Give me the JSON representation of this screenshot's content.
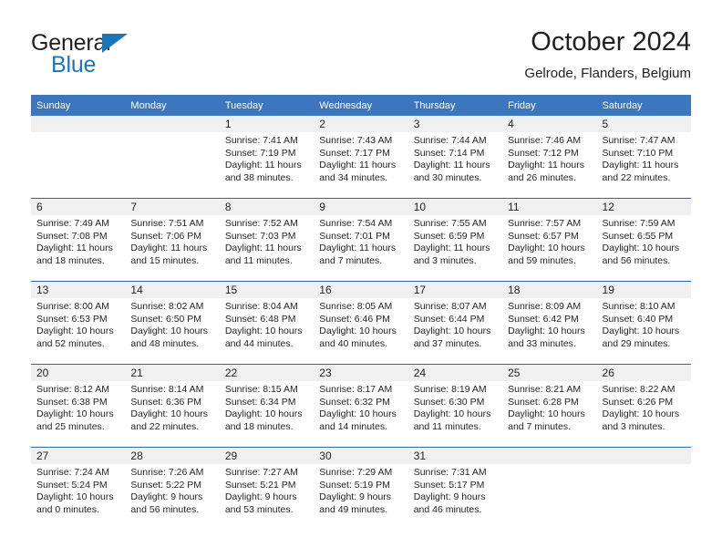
{
  "brand": {
    "name_part1": "General",
    "name_part2": "Blue",
    "accent_color": "#1b75bb",
    "triangle_icon": "brand-triangle-icon"
  },
  "header": {
    "title": "October 2024",
    "subtitle": "Gelrode, Flanders, Belgium"
  },
  "theme": {
    "header_blue": "#3b76bf",
    "row_rule_blue": "#2c6aa8",
    "daynum_band": "#f0f0f0",
    "text": "#231f20"
  },
  "weekday_headers": [
    "Sunday",
    "Monday",
    "Tuesday",
    "Wednesday",
    "Thursday",
    "Friday",
    "Saturday"
  ],
  "weeks": [
    [
      {
        "day": "",
        "sunrise": "",
        "sunset": "",
        "daylight_line1": "",
        "daylight_line2": ""
      },
      {
        "day": "",
        "sunrise": "",
        "sunset": "",
        "daylight_line1": "",
        "daylight_line2": ""
      },
      {
        "day": "1",
        "sunrise": "Sunrise: 7:41 AM",
        "sunset": "Sunset: 7:19 PM",
        "daylight_line1": "Daylight: 11 hours",
        "daylight_line2": "and 38 minutes."
      },
      {
        "day": "2",
        "sunrise": "Sunrise: 7:43 AM",
        "sunset": "Sunset: 7:17 PM",
        "daylight_line1": "Daylight: 11 hours",
        "daylight_line2": "and 34 minutes."
      },
      {
        "day": "3",
        "sunrise": "Sunrise: 7:44 AM",
        "sunset": "Sunset: 7:14 PM",
        "daylight_line1": "Daylight: 11 hours",
        "daylight_line2": "and 30 minutes."
      },
      {
        "day": "4",
        "sunrise": "Sunrise: 7:46 AM",
        "sunset": "Sunset: 7:12 PM",
        "daylight_line1": "Daylight: 11 hours",
        "daylight_line2": "and 26 minutes."
      },
      {
        "day": "5",
        "sunrise": "Sunrise: 7:47 AM",
        "sunset": "Sunset: 7:10 PM",
        "daylight_line1": "Daylight: 11 hours",
        "daylight_line2": "and 22 minutes."
      }
    ],
    [
      {
        "day": "6",
        "sunrise": "Sunrise: 7:49 AM",
        "sunset": "Sunset: 7:08 PM",
        "daylight_line1": "Daylight: 11 hours",
        "daylight_line2": "and 18 minutes."
      },
      {
        "day": "7",
        "sunrise": "Sunrise: 7:51 AM",
        "sunset": "Sunset: 7:06 PM",
        "daylight_line1": "Daylight: 11 hours",
        "daylight_line2": "and 15 minutes."
      },
      {
        "day": "8",
        "sunrise": "Sunrise: 7:52 AM",
        "sunset": "Sunset: 7:03 PM",
        "daylight_line1": "Daylight: 11 hours",
        "daylight_line2": "and 11 minutes."
      },
      {
        "day": "9",
        "sunrise": "Sunrise: 7:54 AM",
        "sunset": "Sunset: 7:01 PM",
        "daylight_line1": "Daylight: 11 hours",
        "daylight_line2": "and 7 minutes."
      },
      {
        "day": "10",
        "sunrise": "Sunrise: 7:55 AM",
        "sunset": "Sunset: 6:59 PM",
        "daylight_line1": "Daylight: 11 hours",
        "daylight_line2": "and 3 minutes."
      },
      {
        "day": "11",
        "sunrise": "Sunrise: 7:57 AM",
        "sunset": "Sunset: 6:57 PM",
        "daylight_line1": "Daylight: 10 hours",
        "daylight_line2": "and 59 minutes."
      },
      {
        "day": "12",
        "sunrise": "Sunrise: 7:59 AM",
        "sunset": "Sunset: 6:55 PM",
        "daylight_line1": "Daylight: 10 hours",
        "daylight_line2": "and 56 minutes."
      }
    ],
    [
      {
        "day": "13",
        "sunrise": "Sunrise: 8:00 AM",
        "sunset": "Sunset: 6:53 PM",
        "daylight_line1": "Daylight: 10 hours",
        "daylight_line2": "and 52 minutes."
      },
      {
        "day": "14",
        "sunrise": "Sunrise: 8:02 AM",
        "sunset": "Sunset: 6:50 PM",
        "daylight_line1": "Daylight: 10 hours",
        "daylight_line2": "and 48 minutes."
      },
      {
        "day": "15",
        "sunrise": "Sunrise: 8:04 AM",
        "sunset": "Sunset: 6:48 PM",
        "daylight_line1": "Daylight: 10 hours",
        "daylight_line2": "and 44 minutes."
      },
      {
        "day": "16",
        "sunrise": "Sunrise: 8:05 AM",
        "sunset": "Sunset: 6:46 PM",
        "daylight_line1": "Daylight: 10 hours",
        "daylight_line2": "and 40 minutes."
      },
      {
        "day": "17",
        "sunrise": "Sunrise: 8:07 AM",
        "sunset": "Sunset: 6:44 PM",
        "daylight_line1": "Daylight: 10 hours",
        "daylight_line2": "and 37 minutes."
      },
      {
        "day": "18",
        "sunrise": "Sunrise: 8:09 AM",
        "sunset": "Sunset: 6:42 PM",
        "daylight_line1": "Daylight: 10 hours",
        "daylight_line2": "and 33 minutes."
      },
      {
        "day": "19",
        "sunrise": "Sunrise: 8:10 AM",
        "sunset": "Sunset: 6:40 PM",
        "daylight_line1": "Daylight: 10 hours",
        "daylight_line2": "and 29 minutes."
      }
    ],
    [
      {
        "day": "20",
        "sunrise": "Sunrise: 8:12 AM",
        "sunset": "Sunset: 6:38 PM",
        "daylight_line1": "Daylight: 10 hours",
        "daylight_line2": "and 25 minutes."
      },
      {
        "day": "21",
        "sunrise": "Sunrise: 8:14 AM",
        "sunset": "Sunset: 6:36 PM",
        "daylight_line1": "Daylight: 10 hours",
        "daylight_line2": "and 22 minutes."
      },
      {
        "day": "22",
        "sunrise": "Sunrise: 8:15 AM",
        "sunset": "Sunset: 6:34 PM",
        "daylight_line1": "Daylight: 10 hours",
        "daylight_line2": "and 18 minutes."
      },
      {
        "day": "23",
        "sunrise": "Sunrise: 8:17 AM",
        "sunset": "Sunset: 6:32 PM",
        "daylight_line1": "Daylight: 10 hours",
        "daylight_line2": "and 14 minutes."
      },
      {
        "day": "24",
        "sunrise": "Sunrise: 8:19 AM",
        "sunset": "Sunset: 6:30 PM",
        "daylight_line1": "Daylight: 10 hours",
        "daylight_line2": "and 11 minutes."
      },
      {
        "day": "25",
        "sunrise": "Sunrise: 8:21 AM",
        "sunset": "Sunset: 6:28 PM",
        "daylight_line1": "Daylight: 10 hours",
        "daylight_line2": "and 7 minutes."
      },
      {
        "day": "26",
        "sunrise": "Sunrise: 8:22 AM",
        "sunset": "Sunset: 6:26 PM",
        "daylight_line1": "Daylight: 10 hours",
        "daylight_line2": "and 3 minutes."
      }
    ],
    [
      {
        "day": "27",
        "sunrise": "Sunrise: 7:24 AM",
        "sunset": "Sunset: 5:24 PM",
        "daylight_line1": "Daylight: 10 hours",
        "daylight_line2": "and 0 minutes."
      },
      {
        "day": "28",
        "sunrise": "Sunrise: 7:26 AM",
        "sunset": "Sunset: 5:22 PM",
        "daylight_line1": "Daylight: 9 hours",
        "daylight_line2": "and 56 minutes."
      },
      {
        "day": "29",
        "sunrise": "Sunrise: 7:27 AM",
        "sunset": "Sunset: 5:21 PM",
        "daylight_line1": "Daylight: 9 hours",
        "daylight_line2": "and 53 minutes."
      },
      {
        "day": "30",
        "sunrise": "Sunrise: 7:29 AM",
        "sunset": "Sunset: 5:19 PM",
        "daylight_line1": "Daylight: 9 hours",
        "daylight_line2": "and 49 minutes."
      },
      {
        "day": "31",
        "sunrise": "Sunrise: 7:31 AM",
        "sunset": "Sunset: 5:17 PM",
        "daylight_line1": "Daylight: 9 hours",
        "daylight_line2": "and 46 minutes."
      },
      {
        "day": "",
        "sunrise": "",
        "sunset": "",
        "daylight_line1": "",
        "daylight_line2": ""
      },
      {
        "day": "",
        "sunrise": "",
        "sunset": "",
        "daylight_line1": "",
        "daylight_line2": ""
      }
    ]
  ]
}
